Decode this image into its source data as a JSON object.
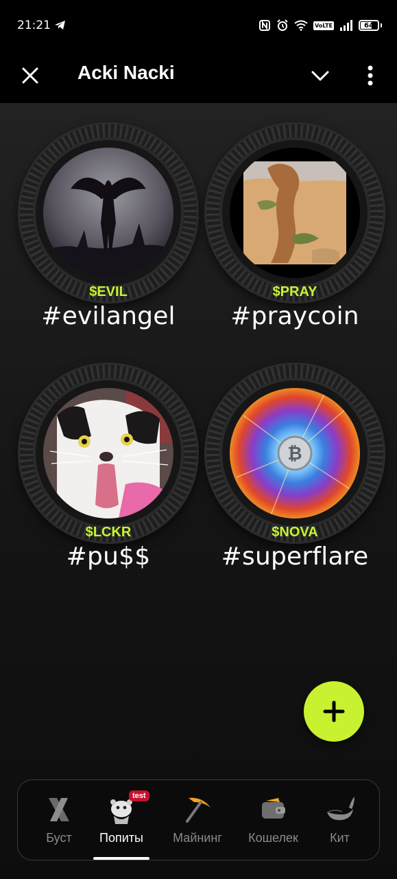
{
  "status_bar": {
    "time": "21:21",
    "volte": "VoLTE",
    "battery": "64"
  },
  "header": {
    "title": "Acki Nacki"
  },
  "coins": [
    {
      "ticker": "$EVIL",
      "tag": "#evilangel"
    },
    {
      "ticker": "$PRAY",
      "tag": "#praycoin"
    },
    {
      "ticker": "$LCKR",
      "tag": "#pu$$"
    },
    {
      "ticker": "$NOVA",
      "tag": "#superflare"
    }
  ],
  "nav": {
    "items": [
      {
        "label": "Буст",
        "icon": "x-logo-icon"
      },
      {
        "label": "Попиты",
        "icon": "mascot-icon",
        "badge": "test"
      },
      {
        "label": "Майнинг",
        "icon": "pickaxe-icon"
      },
      {
        "label": "Кошелек",
        "icon": "wallet-icon"
      },
      {
        "label": "Кит",
        "icon": "whale-icon"
      }
    ]
  },
  "colors": {
    "accent": "#c8f230",
    "ticker": "#c6f432",
    "badge": "#c8102e"
  }
}
